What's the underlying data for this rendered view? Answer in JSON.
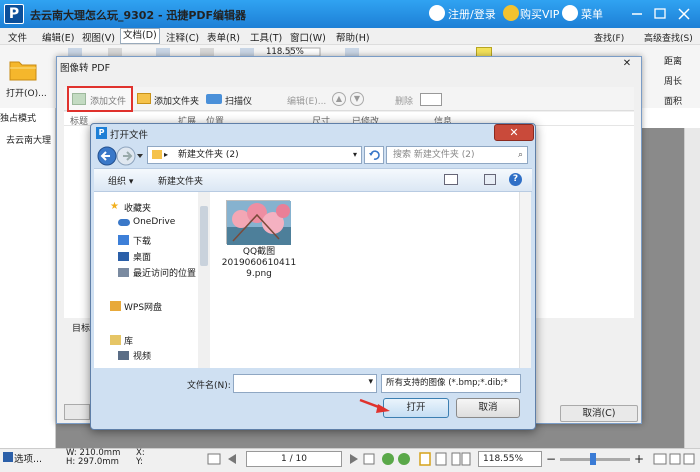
{
  "app": {
    "logo": "P",
    "title": "去云南大理怎么玩_9302 - 迅捷PDF编辑器",
    "login": "注册/登录",
    "vip": "购买VIP",
    "menu_btn": "菜单"
  },
  "menubar": [
    "文件",
    "编辑(E)",
    "视图(V)",
    "文档(D)",
    "注释(C)",
    "表单(R)",
    "工具(T)",
    "窗口(W)",
    "帮助(H)"
  ],
  "toolbar": {
    "open": "打开(O)...",
    "zoom_value": "118.55%",
    "right_tools": [
      "查找(F)",
      "高级查找(S)",
      "距离",
      "周长",
      "面积"
    ]
  },
  "sidebar": {
    "solo_tab": "独占模式",
    "doc_tab": "去云南大理"
  },
  "image_to_pdf": {
    "title": "图像转 PDF",
    "buttons": [
      "添加文件",
      "添加文件夹",
      "扫描仪",
      "编辑(E)...",
      "删除"
    ],
    "columns": [
      "标题",
      "扩展",
      "位置",
      "尺寸",
      "已修改",
      "信息"
    ],
    "target_label": "目标",
    "cancel": "取消(C)"
  },
  "open_dialog": {
    "title": "打开文件",
    "address": "新建文件夹 (2)",
    "search_placeholder": "搜索 新建文件夹 (2)",
    "organize": "组织",
    "new_folder": "新建文件夹",
    "nav": {
      "favorites": "收藏夹",
      "onedrive": "OneDrive",
      "downloads": "下载",
      "desktop": "桌面",
      "recent": "最近访问的位置",
      "wps": "WPS网盘",
      "library": "库",
      "videos": "视频"
    },
    "file": {
      "name_line1": "QQ截图",
      "name_line2": "2019060610411",
      "name_line3": "9.png"
    },
    "filename_label": "文件名(N):",
    "filename_value": "",
    "file_filter": "所有支持的图像 (*.bmp;*.dib;*",
    "open_button": "打开",
    "cancel_button": "取消"
  },
  "statusbar": {
    "mode": "选项...",
    "width": "W: 210.0mm",
    "height": "H: 297.0mm",
    "x": "X:",
    "y": "Y:",
    "page": "1 / 10",
    "zoom": "118.55%"
  },
  "colors": {
    "titlebar": "#1d7fd6",
    "highlight": "#e0322d",
    "vip": "#f2c230"
  }
}
